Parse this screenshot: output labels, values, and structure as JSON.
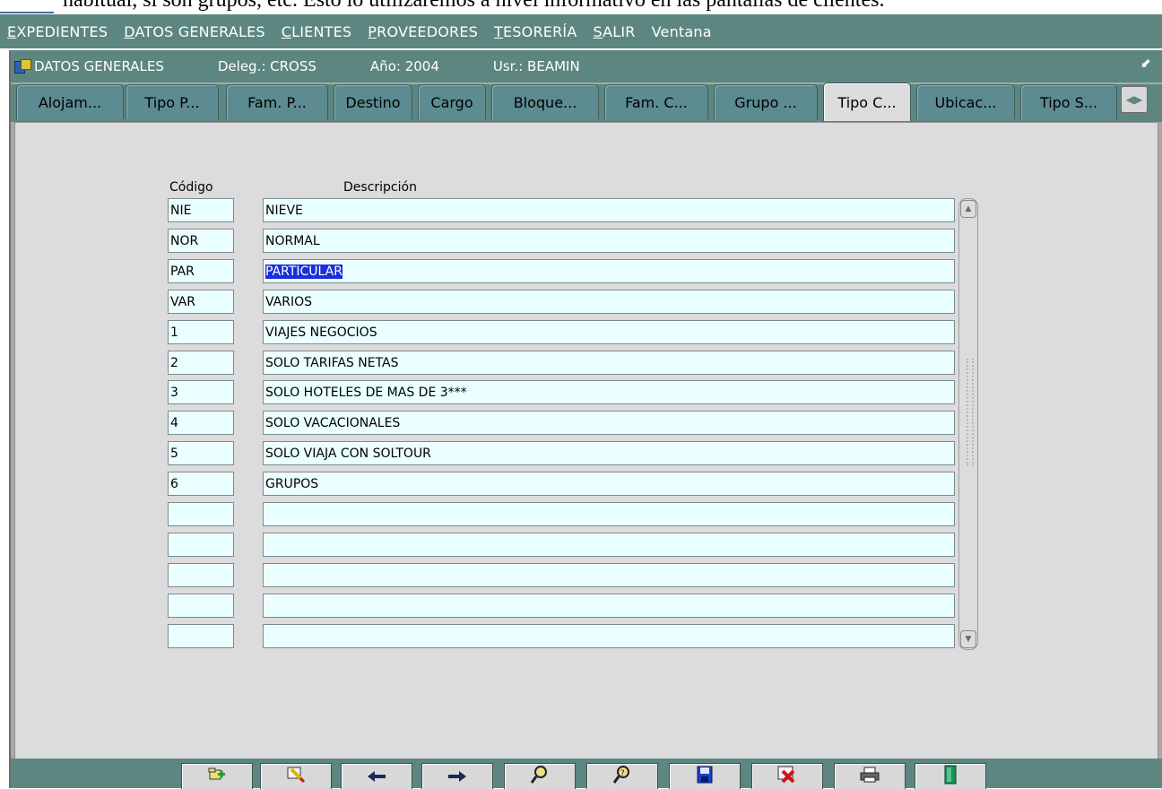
{
  "doc_text": "habitual, si son grupos, etc. Esto lo utilizaremos a nivel informativo en las pantallas de clientes.",
  "menu": [
    {
      "u": "E",
      "rest": "XPEDIENTES"
    },
    {
      "u": "D",
      "rest": "ATOS GENERALES"
    },
    {
      "u": "C",
      "rest": "LIENTES"
    },
    {
      "u": "P",
      "rest": "ROVEEDORES"
    },
    {
      "u": "T",
      "rest": "ESORERÍA"
    },
    {
      "u": "S",
      "rest": "ALIR"
    },
    {
      "u": "",
      "rest": "Ventana"
    }
  ],
  "titlebar": {
    "title": "DATOS GENERALES",
    "deleg": "Deleg.: CROSS",
    "anio": "Año: 2004",
    "usr": "Usr.: BEAMIN",
    "minimize_glyph": "⬋"
  },
  "tabs": [
    "Alojam...",
    "Tipo P...",
    "Fam. P...",
    "Destino",
    "Cargo",
    "Bloque...",
    "Fam. C...",
    "Grupo ...",
    "Tipo C...",
    "Ubicac...",
    "Tipo S..."
  ],
  "active_tab": "Tipo C...",
  "form": {
    "codigo_label": "Código",
    "descripcion_label": "Descripción",
    "rows": [
      {
        "code": "NIE",
        "desc": "NIEVE",
        "selected": false
      },
      {
        "code": "NOR",
        "desc": "NORMAL",
        "selected": false
      },
      {
        "code": "PAR",
        "desc": "PARTICULAR",
        "selected": true
      },
      {
        "code": "VAR",
        "desc": "VARIOS",
        "selected": false
      },
      {
        "code": "1",
        "desc": "VIAJES NEGOCIOS",
        "selected": false
      },
      {
        "code": "2",
        "desc": "SOLO TARIFAS NETAS",
        "selected": false
      },
      {
        "code": "3",
        "desc": "SOLO HOTELES DE MAS DE 3***",
        "selected": false
      },
      {
        "code": "4",
        "desc": "SOLO VACACIONALES",
        "selected": false
      },
      {
        "code": "5",
        "desc": "SOLO VIAJA CON SOLTOUR",
        "selected": false
      },
      {
        "code": "6",
        "desc": "GRUPOS",
        "selected": false
      },
      {
        "code": "",
        "desc": "",
        "selected": false
      },
      {
        "code": "",
        "desc": "",
        "selected": false
      },
      {
        "code": "",
        "desc": "",
        "selected": false
      },
      {
        "code": "",
        "desc": "",
        "selected": false
      },
      {
        "code": "",
        "desc": "",
        "selected": false
      }
    ]
  },
  "toolbar": [
    {
      "name": "new-record-button",
      "icon": "new-record-icon"
    },
    {
      "name": "edit-record-button",
      "icon": "edit-pencil-icon"
    },
    {
      "name": "previous-record-button",
      "icon": "arrow-left-icon"
    },
    {
      "name": "next-record-button",
      "icon": "arrow-right-icon"
    },
    {
      "name": "query-button",
      "icon": "query-icon"
    },
    {
      "name": "execute-query-button",
      "icon": "execute-query-icon"
    },
    {
      "name": "save-button",
      "icon": "save-disk-icon"
    },
    {
      "name": "delete-button",
      "icon": "delete-x-icon"
    },
    {
      "name": "print-button",
      "icon": "printer-icon"
    },
    {
      "name": "exit-button",
      "icon": "exit-door-icon"
    }
  ],
  "colors": {
    "accent": "#5d8680",
    "field_bg": "#eaffff",
    "selection": "#1a2fdb"
  }
}
